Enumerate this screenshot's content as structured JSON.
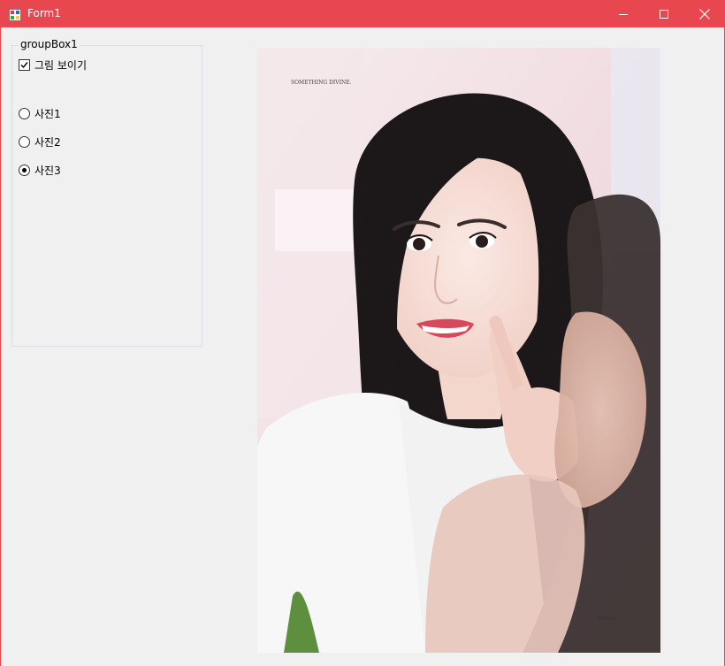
{
  "window": {
    "title": "Form1",
    "accent_color": "#e8474f",
    "icons": [
      "app-icon",
      "minimize-icon",
      "maximize-icon",
      "close-icon"
    ]
  },
  "groupbox": {
    "title": "groupBox1",
    "checkbox": {
      "label": "그림 보이기",
      "checked": true
    },
    "radios": [
      {
        "label": "사진1",
        "selected": false
      },
      {
        "label": "사진2",
        "selected": false
      },
      {
        "label": "사진3",
        "selected": true
      }
    ]
  },
  "picture": {
    "caption": "SOMETHING DIVINE.",
    "corner_mark": "EMBRACE"
  }
}
